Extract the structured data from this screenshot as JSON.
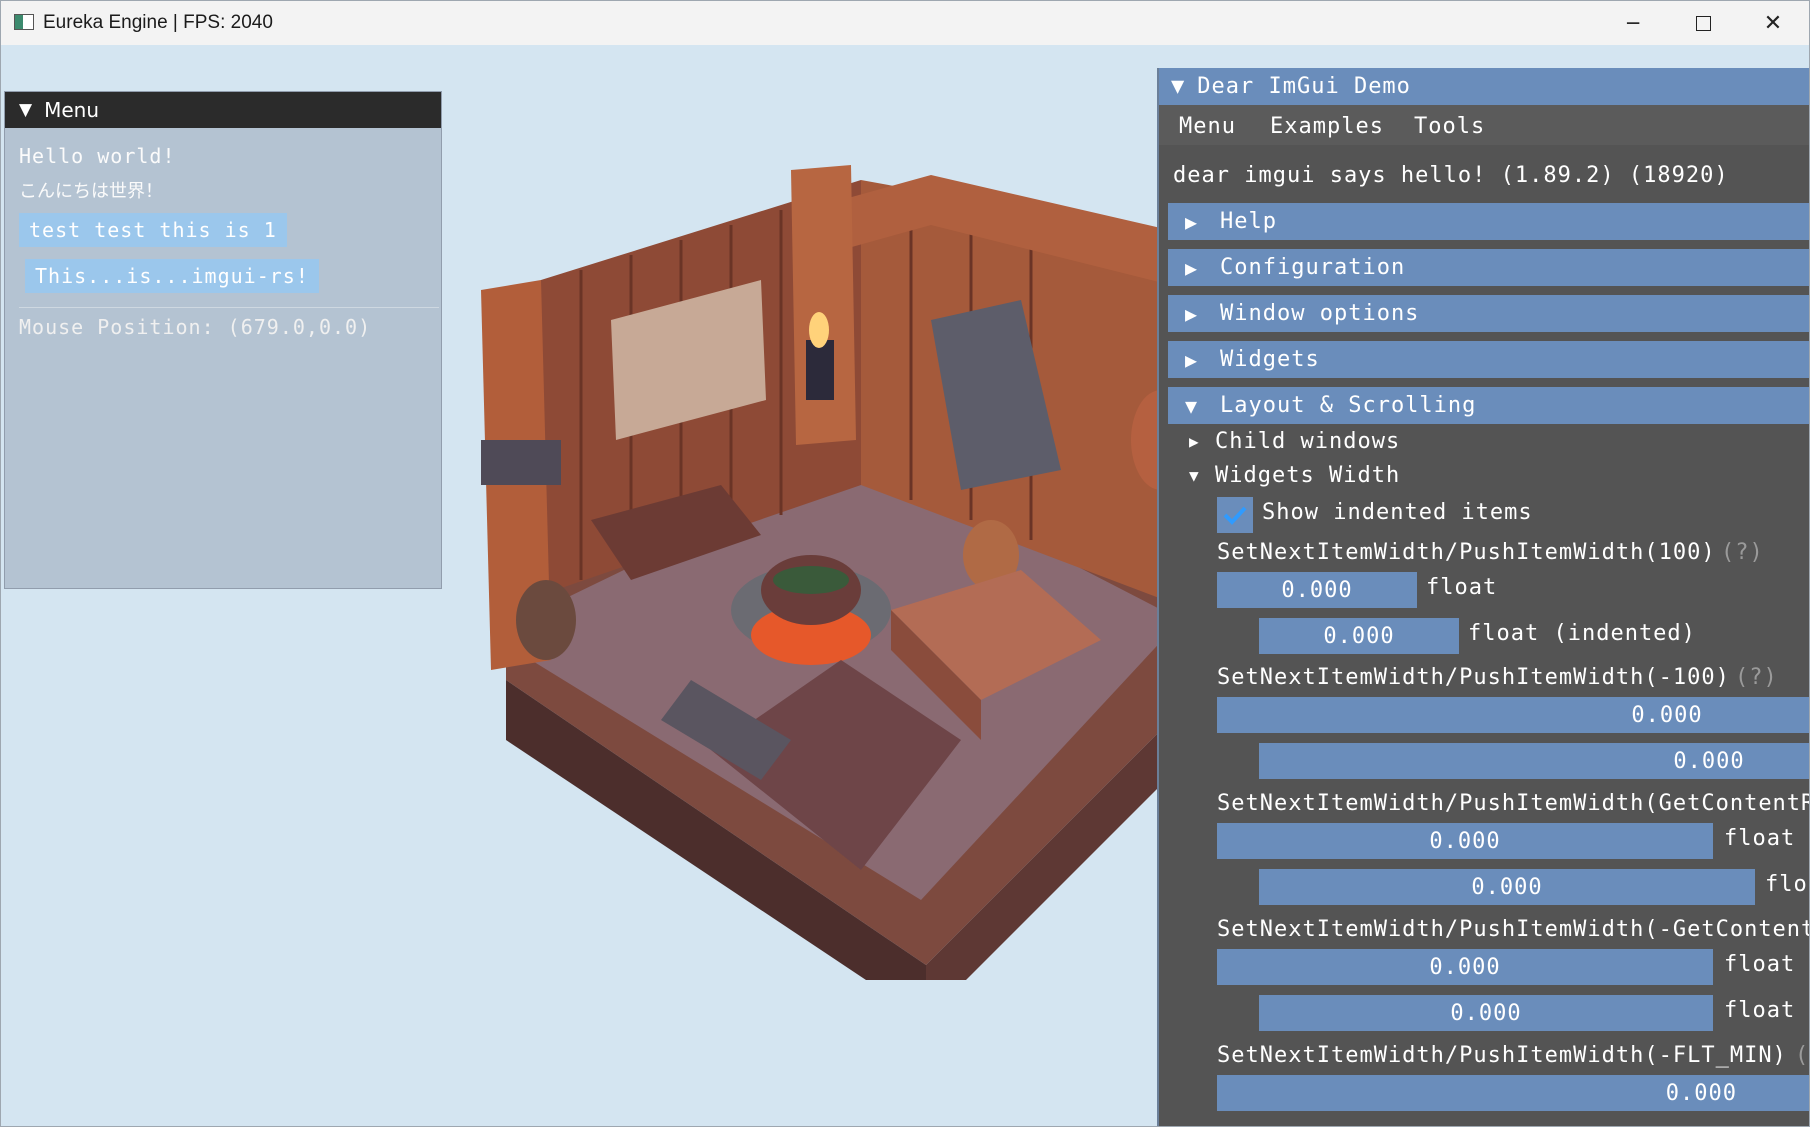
{
  "window": {
    "title": "Eureka Engine | FPS: 2040"
  },
  "menu_window": {
    "title": "Menu",
    "hello": "Hello world!",
    "hello_jp": "こんにちは世界！",
    "button1": "test test this is 1",
    "button2": "This...is...imgui-rs!",
    "mouse_position": "Mouse Position: (679.0,0.0)"
  },
  "demo": {
    "title": "Dear ImGui Demo",
    "menubar": [
      "Menu",
      "Examples",
      "Tools"
    ],
    "hello": "dear imgui says hello! (1.89.2) (18920)",
    "headers": {
      "help": "Help",
      "configuration": "Configuration",
      "window_options": "Window options",
      "widgets": "Widgets",
      "layout": "Layout & Scrolling"
    },
    "child_windows": "Child windows",
    "widgets_width": "Widgets Width",
    "show_indented": "Show indented items",
    "show_indented_checked": true,
    "help_marker": "(?)",
    "sections": [
      {
        "label": "SetNextItemWidth/PushItemWidth(100)",
        "f1": "0.000",
        "l1": "float",
        "f2": "0.000",
        "l2": "float (indented)"
      },
      {
        "label": "SetNextItemWidth/PushItemWidth(-100)",
        "f1": "0.000",
        "f2": "0.000"
      },
      {
        "label": "SetNextItemWidth/PushItemWidth(GetContentRe",
        "f1": "0.000",
        "l1": "float",
        "f2": "0.000",
        "l2": "flo"
      },
      {
        "label": "SetNextItemWidth/PushItemWidth(-GetContentR",
        "f1": "0.000",
        "l1": "float",
        "f2": "0.000",
        "l2": "float ("
      },
      {
        "label": "SetNextItemWidth/PushItemWidth(-FLT_MIN)",
        "help": "(",
        "f1": "0.000"
      }
    ]
  },
  "colors": {
    "imgui_blue": "#6a8dbb",
    "imgui_bg": "#545454",
    "button_blue": "#9bc7ec"
  }
}
